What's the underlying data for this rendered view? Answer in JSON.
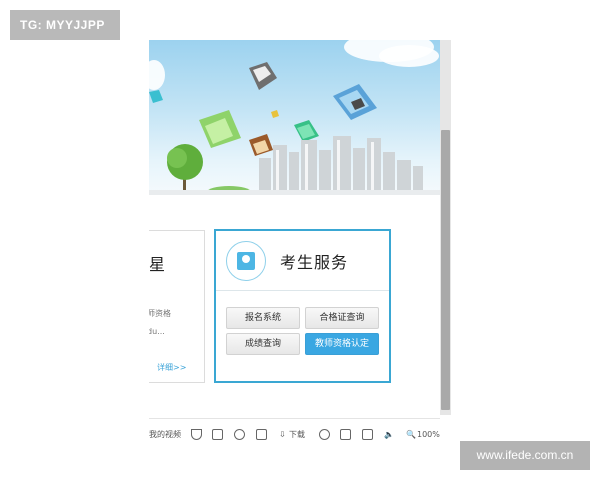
{
  "watermarks": {
    "top_left": "TG: MYYJJPP",
    "bottom_right": "www.ifede.com.cn"
  },
  "left_card": {
    "title_partial": "星",
    "desc_line1": "师资格",
    "desc_line2": "du...",
    "more_link": "详细>>"
  },
  "exam_services": {
    "title": "考生服务",
    "buttons": {
      "registration": "报名系统",
      "certificate_query": "合格证查询",
      "score_query": "成绩查询",
      "teacher_cert": "教师资格认定"
    }
  },
  "toolbar": {
    "my_videos": "我的视频",
    "download": "下载",
    "zoom": "100%"
  },
  "colors": {
    "accent": "#3aa7d3",
    "primary_button": "#3aa7e2",
    "scrollbar_thumb": "#a9a9a9"
  }
}
